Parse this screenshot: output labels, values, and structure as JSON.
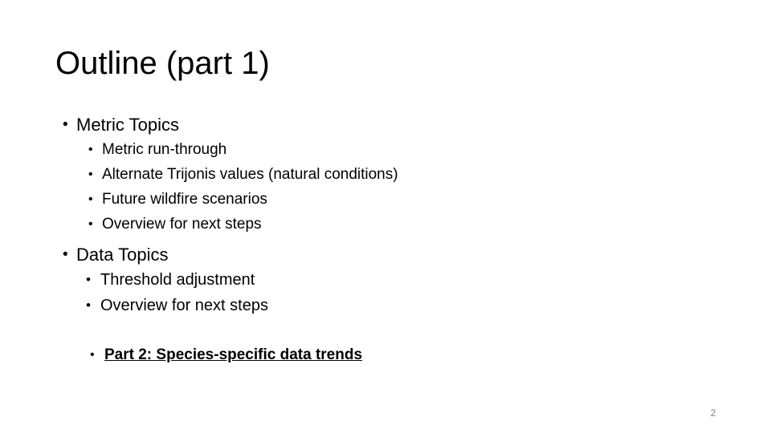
{
  "slide": {
    "title": "Outline (part 1)",
    "page_number": "2",
    "bullet_glyph": "•",
    "sections": [
      {
        "heading": "Metric Topics",
        "items": [
          "Metric run-through",
          "Alternate Trijonis values (natural conditions)",
          "Future wildfire scenarios",
          "Overview for next steps"
        ]
      },
      {
        "heading": "Data Topics",
        "items": [
          "Threshold adjustment",
          "Overview for next steps"
        ],
        "highlight": "Part 2: Species-specific data trends"
      }
    ],
    "colors": {
      "background": "#ffffff",
      "text": "#000000",
      "page_number": "#808080"
    }
  }
}
